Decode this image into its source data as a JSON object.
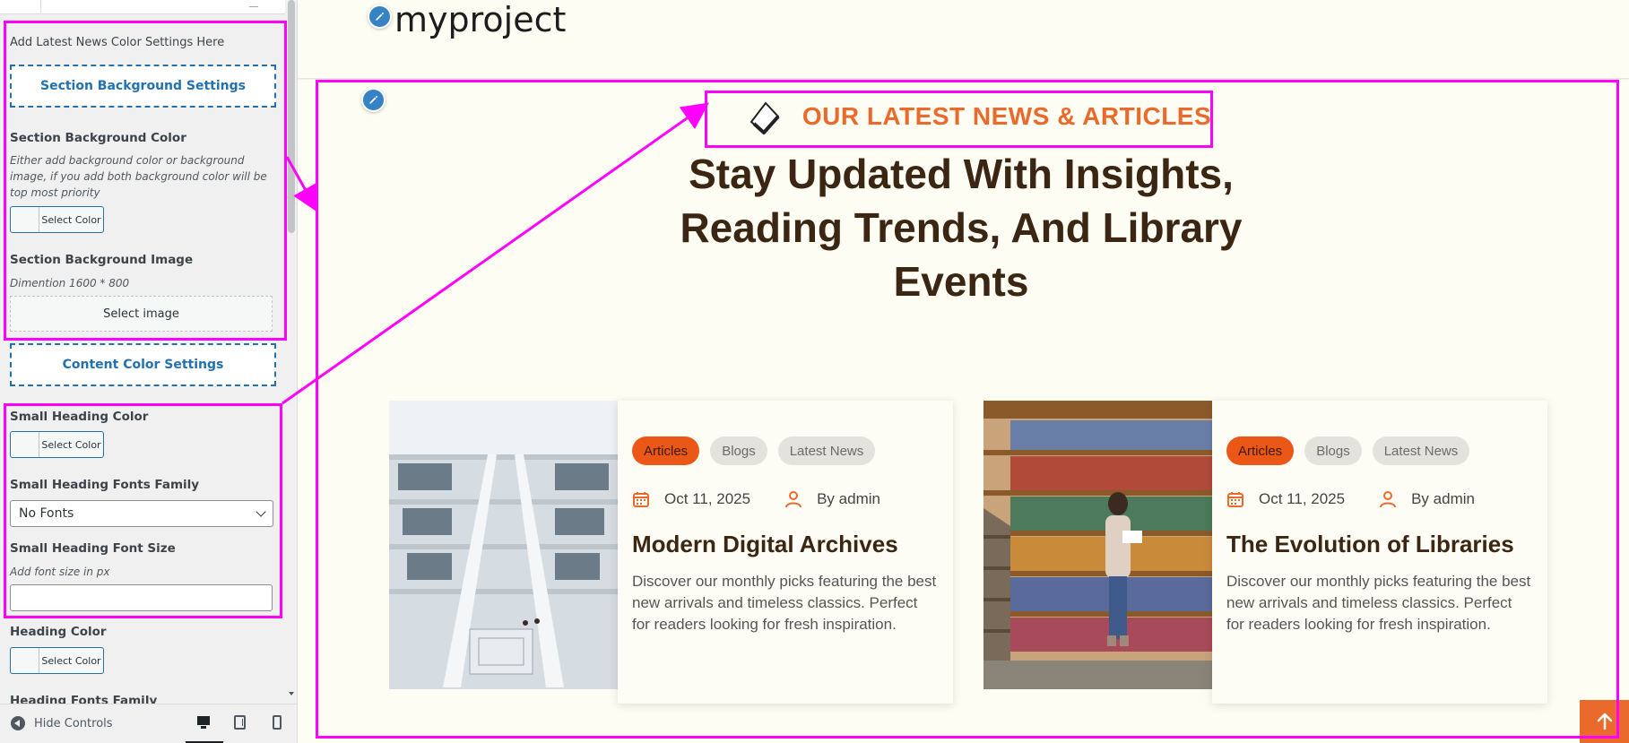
{
  "customizer": {
    "intro_text": "Add Latest News Color Settings Here",
    "section_bg_button": "Section Background Settings",
    "bg_color": {
      "label": "Section Background Color",
      "description": "Either add background color or background image, if you add both background color will be top most priority",
      "button": "Select Color"
    },
    "bg_image": {
      "label": "Section Background Image",
      "description": "Dimention 1600 * 800",
      "button": "Select image"
    },
    "content_color_button": "Content Color Settings",
    "small_heading_color": {
      "label": "Small Heading Color",
      "button": "Select Color"
    },
    "small_heading_font_family": {
      "label": "Small Heading Fonts Family",
      "value": "No Fonts"
    },
    "small_heading_font_size": {
      "label": "Small Heading Font Size",
      "description": "Add font size in px",
      "value": ""
    },
    "heading_color": {
      "label": "Heading Color",
      "button": "Select Color"
    },
    "heading_font_family": {
      "label": "Heading Fonts Family"
    },
    "footer": {
      "hide_controls": "Hide Controls"
    }
  },
  "preview": {
    "site_title": "myproject",
    "small_heading": "OUR LATEST NEWS & ARTICLES",
    "heading": "Stay Updated With Insights, Reading Trends, And Library Events",
    "cards": [
      {
        "tags": [
          "Articles",
          "Blogs",
          "Latest News"
        ],
        "date": "Oct 11, 2025",
        "author": "By admin",
        "title": "Modern Digital Archives",
        "description": "Discover our monthly picks featuring the best new arrivals and timeless classics. Perfect for readers looking for fresh inspiration.",
        "image": "library-atrium-photo"
      },
      {
        "tags": [
          "Articles",
          "Blogs",
          "Latest News"
        ],
        "date": "Oct 11, 2025",
        "author": "By admin",
        "title": "The Evolution of Libraries",
        "description": "Discover our monthly picks featuring the best new arrivals and timeless classics. Perfect for readers looking for fresh inspiration.",
        "image": "woman-reading-at-bookshelf-photo"
      }
    ]
  },
  "colors": {
    "accent_orange": "#ea6a2b",
    "heading_brown": "#3b2614",
    "wp_blue": "#2271b1",
    "annotation_magenta": "#ff00ff",
    "preview_bg": "#fefdf3"
  }
}
